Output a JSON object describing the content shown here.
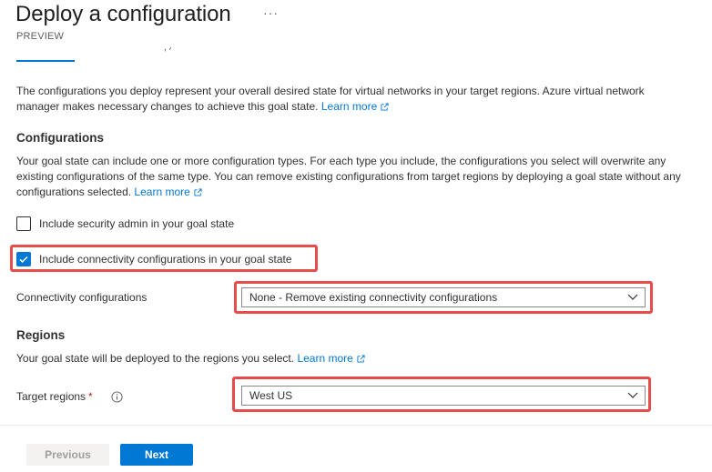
{
  "header": {
    "title": "Deploy a configuration",
    "more_icon": "ellipsis-icon",
    "badge": "PREVIEW"
  },
  "intro": {
    "text": "The configurations you deploy represent your overall desired state for virtual networks in your target regions. Azure virtual network manager makes necessary changes to achieve this goal state.",
    "link": "Learn more"
  },
  "configurations": {
    "heading": "Configurations",
    "text": "Your goal state can include one or more configuration types. For each type you include, the configurations you select will overwrite any existing configurations of the same type. You can remove existing configurations from target regions by deploying a goal state without any configurations selected.",
    "link": "Learn more",
    "security_admin_label": "Include security admin in your goal state",
    "security_admin_checked": false,
    "connectivity_label": "Include connectivity configurations in your goal state",
    "connectivity_checked": true,
    "connectivity_field_label": "Connectivity configurations",
    "connectivity_value": "None - Remove existing connectivity configurations"
  },
  "regions": {
    "heading": "Regions",
    "text": "Your goal state will be deployed to the regions you select.",
    "link": "Learn more",
    "target_label": "Target regions",
    "required_marker": "*",
    "target_value": "West US"
  },
  "footer": {
    "previous_label": "Previous",
    "next_label": "Next"
  },
  "colors": {
    "accent": "#0078d4",
    "highlight": "#e74c4c"
  }
}
